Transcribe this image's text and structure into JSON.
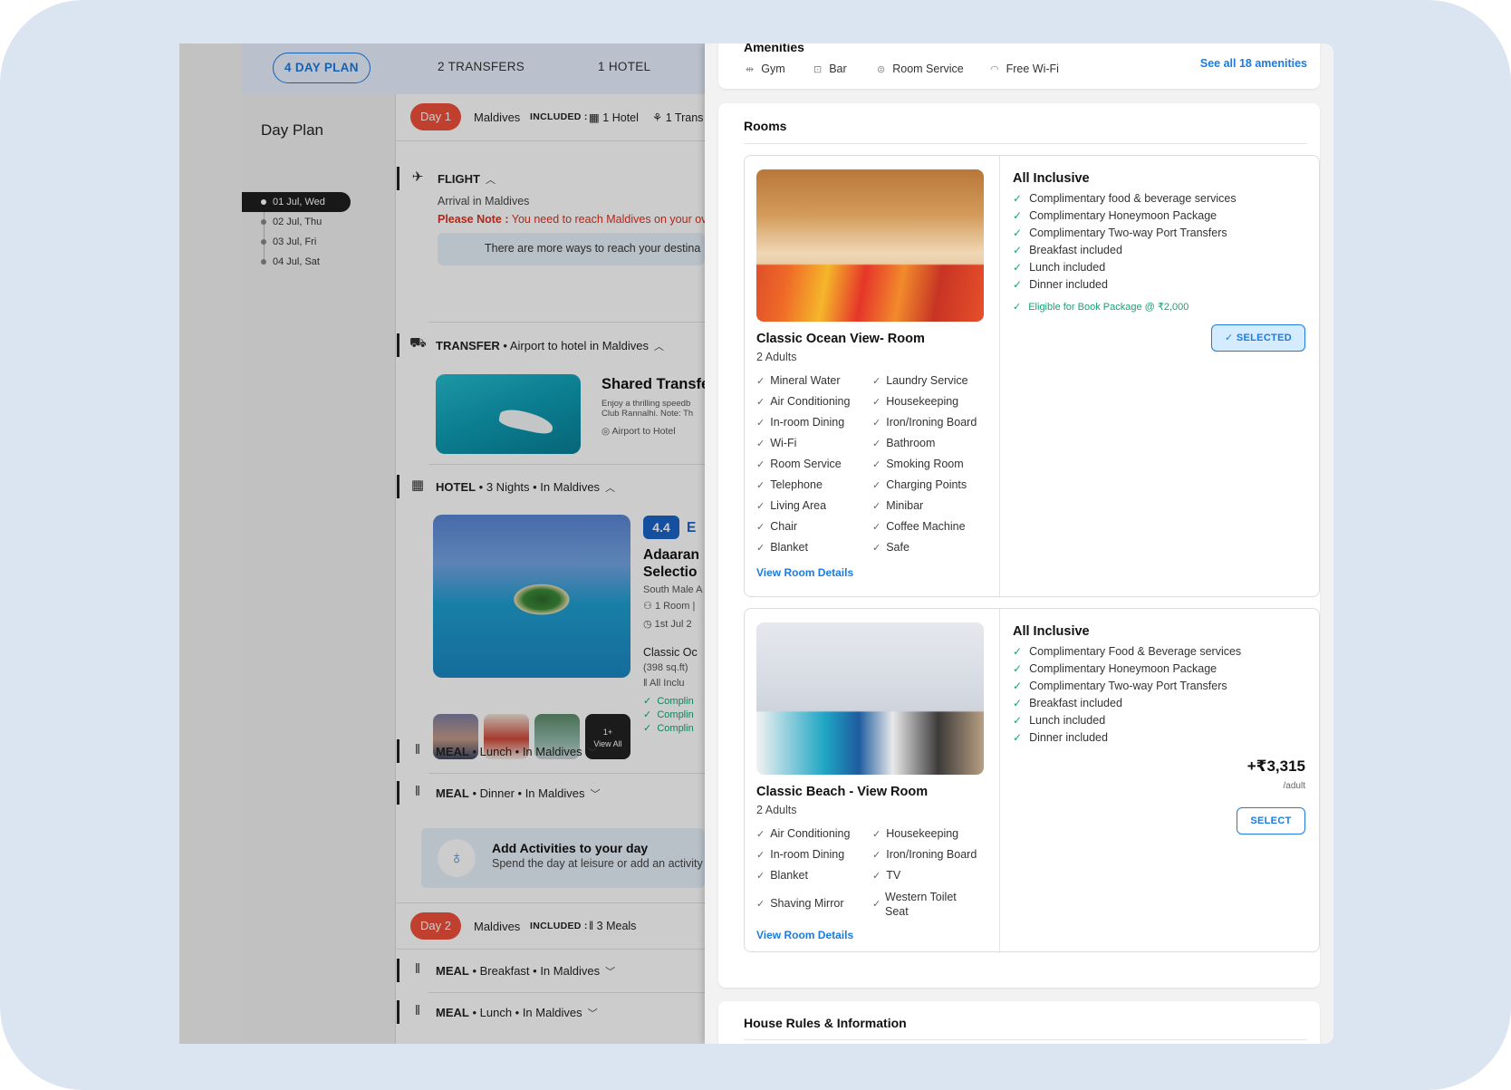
{
  "tabs": [
    {
      "label": "4 DAY PLAN"
    },
    {
      "label": "2 TRANSFERS"
    },
    {
      "label": "1 HOTEL"
    }
  ],
  "sidebar": {
    "title": "Day Plan",
    "dates": [
      "01 Jul, Wed",
      "02 Jul, Thu",
      "03 Jul, Fri",
      "04 Jul, Sat"
    ]
  },
  "day1": {
    "pill": "Day 1",
    "destination": "Maldives",
    "included_label": "INCLUDED :",
    "included_hotel": "1 Hotel",
    "included_transfer": "1 Trans"
  },
  "flight": {
    "label": "FLIGHT",
    "arrival": "Arrival in Maldives",
    "note_label": "Please Note :",
    "note_text": "You need to reach Maldives on your ov",
    "info": "There are more ways to reach your destina"
  },
  "transfer": {
    "label": "TRANSFER",
    "detail": "Airport to hotel in Maldives",
    "title": "Shared Transfe",
    "desc1": "Enjoy a thrilling speedb",
    "desc2": "Club Rannalhi. Note: Th",
    "route": "Airport to Hotel"
  },
  "hotel": {
    "label": "HOTEL",
    "detail": "3 Nights • In Maldives",
    "rating": "4.4",
    "rating_word": "E",
    "name_line1": "Adaaran",
    "name_line2": "Selectio",
    "location": "South Male A",
    "rooms": "1 Room |",
    "dates": "1st Jul 2",
    "room_type": "Classic Oc",
    "size": "(398 sq.ft)",
    "plan": "All Inclu",
    "perks": [
      "Complin",
      "Complin",
      "Complin"
    ],
    "thumb_more": "1+",
    "thumb_view": "View All"
  },
  "meals_day1": [
    {
      "label": "MEAL",
      "detail": "Lunch • In Maldives"
    },
    {
      "label": "MEAL",
      "detail": "Dinner • In Maldives"
    }
  ],
  "activities": {
    "title": "Add Activities to your day",
    "subtitle": "Spend the day at leisure or add an activity"
  },
  "day2": {
    "pill": "Day 2",
    "destination": "Maldives",
    "included_label": "INCLUDED :",
    "included_meals": "3 Meals"
  },
  "meals_day2": [
    {
      "label": "MEAL",
      "detail": "Breakfast • In Maldives"
    },
    {
      "label": "MEAL",
      "detail": "Lunch • In Maldives"
    }
  ],
  "drawer": {
    "amenities_title": "Amenities",
    "amenities": [
      "Gym",
      "Bar",
      "Room Service",
      "Free Wi-Fi"
    ],
    "see_all": "See all 18 amenities",
    "rooms_title": "Rooms",
    "house_rules_title": "House Rules & Information",
    "rooms": [
      {
        "name": "Classic Ocean View- Room",
        "guests": "2 Adults",
        "features_left": [
          "Mineral Water",
          "Air Conditioning",
          "In-room Dining",
          "Wi-Fi",
          "Room Service",
          "Telephone",
          "Living Area",
          "Chair",
          "Blanket"
        ],
        "features_right": [
          "Laundry Service",
          "Housekeeping",
          "Iron/Ironing Board",
          "Bathroom",
          "Smoking Room",
          "Charging Points",
          "Minibar",
          "Coffee Machine",
          "Safe"
        ],
        "view_details": "View Room Details",
        "plan_title": "All Inclusive",
        "plan_items": [
          "Complimentary food & beverage services",
          "Complimentary Honeymoon Package",
          "Complimentary Two-way Port Transfers",
          "Breakfast included",
          "Lunch included",
          "Dinner included"
        ],
        "eligible": "Eligible for Book Package @ ₹2,000",
        "button": "✓ SELECTED"
      },
      {
        "name": "Classic Beach - View Room",
        "guests": "2 Adults",
        "features_left": [
          "Air Conditioning",
          "In-room Dining",
          "Blanket",
          "Shaving Mirror"
        ],
        "features_right": [
          "Housekeeping",
          "Iron/Ironing Board",
          "TV",
          "Western Toilet Seat"
        ],
        "view_details": "View Room Details",
        "plan_title": "All Inclusive",
        "plan_items": [
          "Complimentary Food & Beverage services",
          "Complimentary Honeymoon Package",
          "Complimentary Two-way Port Transfers",
          "Breakfast included",
          "Lunch included",
          "Dinner included"
        ],
        "price": "+₹3,315",
        "per": "/adult",
        "button": "SELECT"
      }
    ]
  }
}
